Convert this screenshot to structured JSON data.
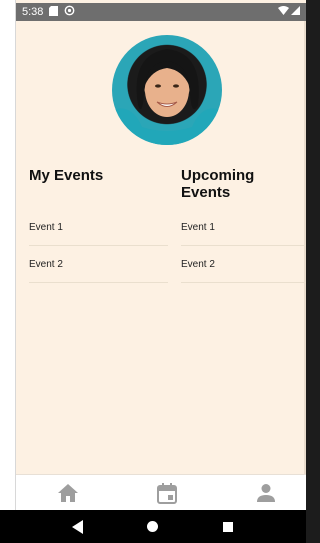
{
  "status_bar": {
    "time": "5:38",
    "icons": [
      "sd-card-icon",
      "sync-icon",
      "wifi-icon",
      "signal-icon"
    ]
  },
  "profile": {
    "avatar": "profile-photo"
  },
  "my_events": {
    "title": "My Events",
    "items": [
      "Event 1",
      "Event 2"
    ]
  },
  "upcoming_events": {
    "title": "Upcoming Events",
    "items": [
      "Event 1",
      "Event 2"
    ]
  },
  "bottom_nav": {
    "items": [
      {
        "icon": "home-icon"
      },
      {
        "icon": "calendar-icon"
      },
      {
        "icon": "person-icon"
      }
    ]
  },
  "system_nav": [
    "back-icon",
    "home-circle-icon",
    "recents-icon"
  ],
  "colors": {
    "background": "#fdf1e3",
    "nav_icon": "#9e9e9e",
    "status_bar": "#6e6e6e"
  }
}
